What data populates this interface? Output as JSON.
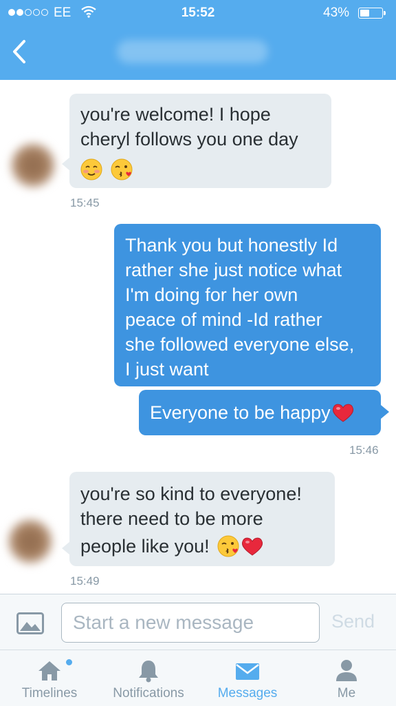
{
  "status_bar": {
    "carrier": "EE",
    "time": "15:52",
    "battery_percent": "43%",
    "battery_level": 0.43,
    "signal_bars_filled": 2
  },
  "nav": {
    "back_icon": "chevron-left-icon"
  },
  "messages": [
    {
      "direction": "incoming",
      "text_lines": [
        "you're welcome! I hope",
        "cheryl follows you one day"
      ],
      "emoji": [
        "smiling-blush-emoji",
        "kissing-heart-emoji"
      ],
      "time": "15:45"
    },
    {
      "direction": "outgoing",
      "text_lines": [
        "Thank you but honestly Id",
        "rather she just notice what",
        "I'm doing for her own",
        "peace of mind -Id rather",
        "she followed everyone else,",
        "I just want"
      ]
    },
    {
      "direction": "outgoing",
      "text": "Everyone to be happy",
      "emoji": [
        "red-heart-emoji"
      ],
      "time": "15:46"
    },
    {
      "direction": "incoming",
      "text_lines": [
        "you're so kind to everyone!",
        "there need to be more",
        "people like you!"
      ],
      "emoji": [
        "kissing-heart-emoji",
        "red-heart-emoji"
      ],
      "time": "15:49"
    }
  ],
  "composer": {
    "placeholder": "Start a new message",
    "value": "",
    "send_label": "Send",
    "photo_icon": "photo-icon"
  },
  "tabs": [
    {
      "label": "Timelines",
      "icon": "home-icon",
      "active": false,
      "badge": true
    },
    {
      "label": "Notifications",
      "icon": "bell-icon",
      "active": false
    },
    {
      "label": "Messages",
      "icon": "envelope-icon",
      "active": true
    },
    {
      "label": "Me",
      "icon": "person-icon",
      "active": false
    }
  ],
  "colors": {
    "accent": "#55acee",
    "outgoing_bubble": "#3e94e0",
    "incoming_bubble": "#e6ecf0",
    "muted_text": "#8899a6"
  }
}
